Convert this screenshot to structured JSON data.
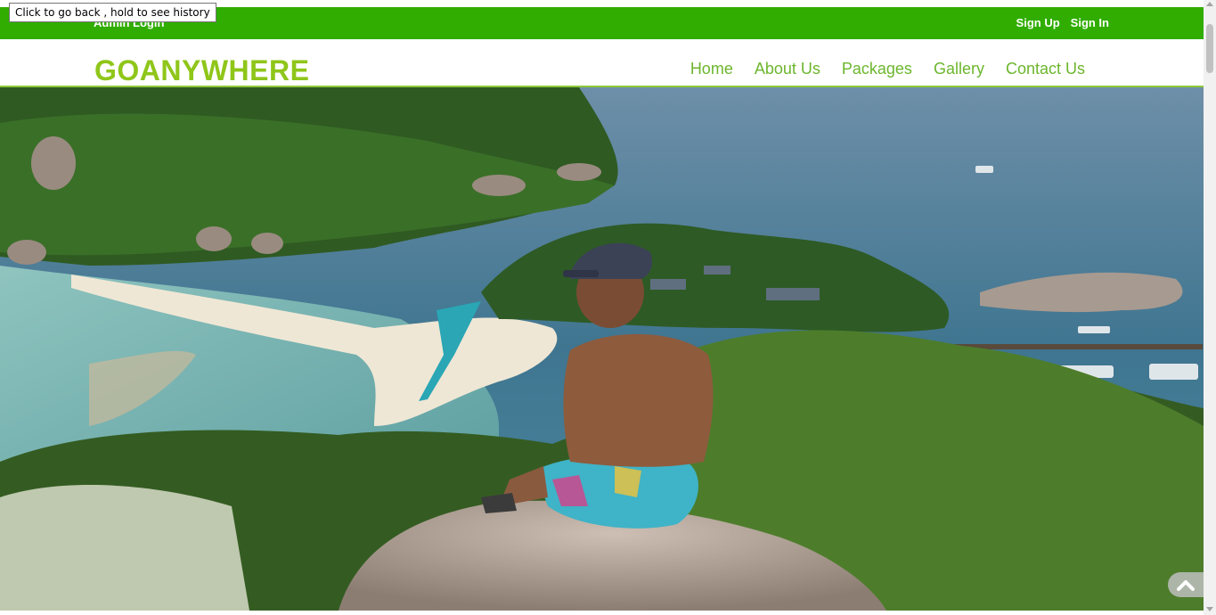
{
  "browser": {
    "tooltip": "Click to go back , hold to see history"
  },
  "topbar": {
    "admin_login": "Admin Login",
    "sign_up": "Sign Up",
    "sign_in": "Sign In"
  },
  "navbar": {
    "logo": "GOANYWHERE",
    "menu": [
      "Home",
      "About Us",
      "Packages",
      "Gallery",
      "Contact Us"
    ]
  },
  "hero": {
    "image": "tropical-island-bay-with-man-sitting-on-rock"
  },
  "controls": {
    "back_to_top_icon": "chevron-up-icon"
  },
  "colors": {
    "topbar": "#30ad00",
    "logo": "#8fc61a",
    "menu_link": "#6cb62d"
  }
}
